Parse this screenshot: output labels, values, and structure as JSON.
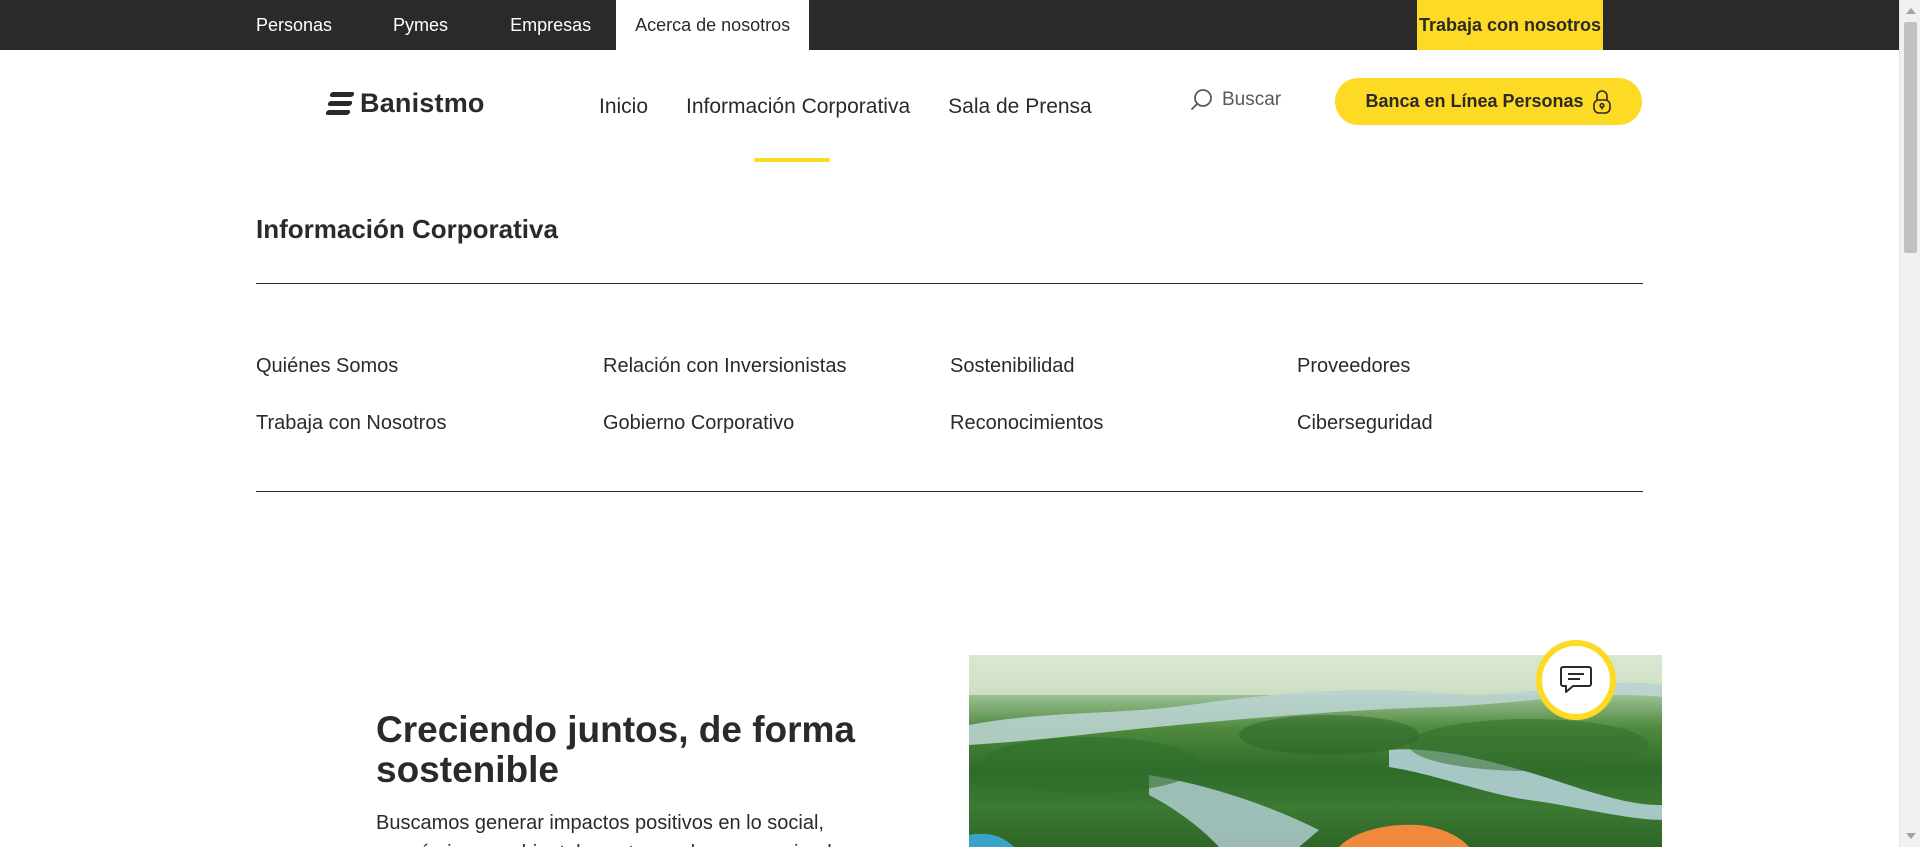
{
  "topbar": {
    "items": [
      {
        "label": "Personas"
      },
      {
        "label": "Pymes"
      },
      {
        "label": "Empresas"
      },
      {
        "label": "Acerca de nosotros",
        "active": true
      }
    ],
    "cta_label": "Trabaja con nosotros"
  },
  "header": {
    "logo_text": "Banistmo",
    "nav": [
      {
        "label": "Inicio"
      },
      {
        "label": "Información Corporativa",
        "active": true
      },
      {
        "label": "Sala de Prensa"
      }
    ],
    "search_label": "Buscar",
    "bank_button_label": "Banca en Línea Personas"
  },
  "menu": {
    "title": "Información Corporativa",
    "links": [
      {
        "label": "Quiénes Somos"
      },
      {
        "label": "Relación con Inversionistas"
      },
      {
        "label": "Sostenibilidad"
      },
      {
        "label": "Proveedores"
      },
      {
        "label": "Trabaja con Nosotros"
      },
      {
        "label": "Gobierno Corporativo"
      },
      {
        "label": "Reconocimientos"
      },
      {
        "label": "Ciberseguridad"
      }
    ]
  },
  "hero": {
    "title": "Creciendo juntos, de forma sostenible",
    "text": "Buscamos generar impactos positivos en lo social, económico y ambiental construyendo y promoviendo"
  },
  "icons": {
    "search": "search-icon",
    "lock": "lock-icon",
    "chat": "chat-icon"
  },
  "colors": {
    "brand_yellow": "#fdda24",
    "dark": "#2c2a29"
  }
}
